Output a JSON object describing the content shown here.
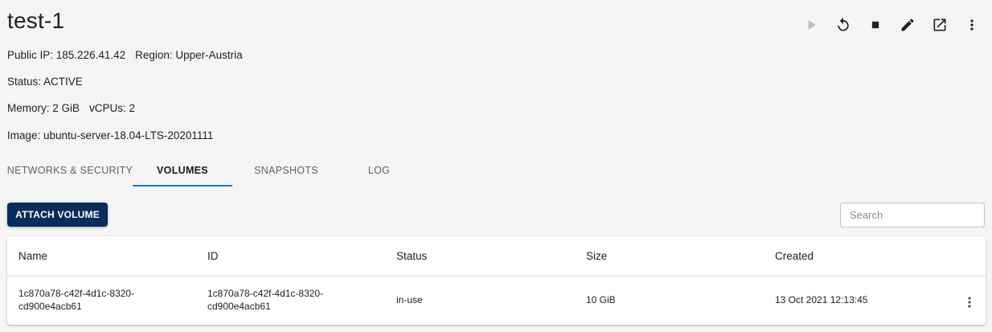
{
  "header": {
    "title": "test-1",
    "toolbar": [
      {
        "icon": "play-icon",
        "enabled": false
      },
      {
        "icon": "restart-icon",
        "enabled": true
      },
      {
        "icon": "stop-icon",
        "enabled": true
      },
      {
        "icon": "edit-icon",
        "enabled": true
      },
      {
        "icon": "open-external-icon",
        "enabled": true
      },
      {
        "icon": "more-vert-icon",
        "enabled": true
      }
    ]
  },
  "details": {
    "public_ip": "Public IP: 185.226.41.42",
    "region": "Region: Upper-Austria",
    "status": "Status: ACTIVE",
    "memory": "Memory: 2 GiB",
    "vcpus": "vCPUs: 2",
    "image": "Image: ubuntu-server-18.04-LTS-20201111"
  },
  "tabs": [
    {
      "label": "NETWORKS & SECURITY",
      "active": false
    },
    {
      "label": "VOLUMES",
      "active": true
    },
    {
      "label": "SNAPSHOTS",
      "active": false
    },
    {
      "label": "LOG",
      "active": false
    }
  ],
  "actions": {
    "attach_label": "ATTACH VOLUME",
    "search_placeholder": "Search"
  },
  "table": {
    "columns": [
      "Name",
      "ID",
      "Status",
      "Size",
      "Created"
    ],
    "rows": [
      {
        "name_line1": "1c870a78-c42f-4d1c-8320-",
        "name_line2": "cd900e4acb61",
        "id_line1": "1c870a78-c42f-4d1c-8320-",
        "id_line2": "cd900e4acb61",
        "status": "in-use",
        "size": "10 GiB",
        "created": "13 Oct 2021 12:13:45"
      }
    ]
  },
  "colors": {
    "primary_button": "#062d5b",
    "tab_indicator": "#1976d2",
    "background": "#f5f5f5"
  }
}
